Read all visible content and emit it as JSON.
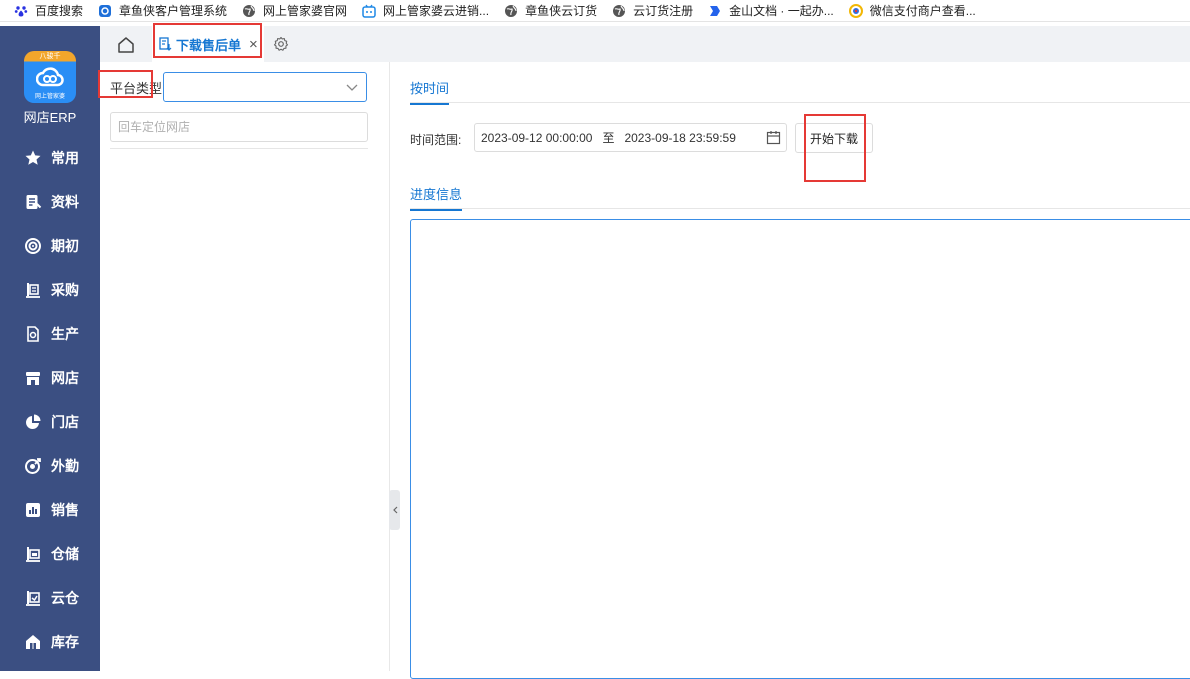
{
  "bookmarks": [
    {
      "label": "百度搜索",
      "icon": "baidu-paw-icon",
      "color": "#2932e1"
    },
    {
      "label": "章鱼侠客户管理系统",
      "icon": "app-square-icon",
      "color": "#1e6fd9"
    },
    {
      "label": "网上管家婆官网",
      "icon": "globe-icon",
      "color": "#555555"
    },
    {
      "label": "网上管家婆云进销...",
      "icon": "robot-tv-icon",
      "color": "#1e88e5"
    },
    {
      "label": "章鱼侠云订货",
      "icon": "globe-icon",
      "color": "#555555"
    },
    {
      "label": "云订货注册",
      "icon": "globe-icon",
      "color": "#555555"
    },
    {
      "label": "金山文档 · 一起办...",
      "icon": "kdocs-icon",
      "color": "#2463eb"
    },
    {
      "label": "微信支付商户查看...",
      "icon": "wechat-pay-icon",
      "color": "#f2b705"
    }
  ],
  "sidebar": {
    "logo_top": "八骏千",
    "logo_sub": "网上管家婆",
    "app_name": "网店ERP",
    "items": [
      {
        "label": "常用",
        "icon": "star-icon"
      },
      {
        "label": "资料",
        "icon": "document-icon"
      },
      {
        "label": "期初",
        "icon": "target-icon"
      },
      {
        "label": "采购",
        "icon": "purchase-icon"
      },
      {
        "label": "生产",
        "icon": "production-icon"
      },
      {
        "label": "网店",
        "icon": "shop-icon"
      },
      {
        "label": "门店",
        "icon": "pie-icon"
      },
      {
        "label": "外勤",
        "icon": "field-icon"
      },
      {
        "label": "销售",
        "icon": "bar-chart-icon"
      },
      {
        "label": "仓储",
        "icon": "warehouse-icon"
      },
      {
        "label": "云仓",
        "icon": "cloud-warehouse-icon"
      },
      {
        "label": "库存",
        "icon": "home-stock-icon"
      }
    ]
  },
  "tabs": {
    "active_label": "下载售后单",
    "close_glyph": "×"
  },
  "left_panel": {
    "platform_label": "平台类型",
    "platform_value": "",
    "shop_search_placeholder": "回车定位网店"
  },
  "right_panel": {
    "tab_time": "按时间",
    "time_range_label": "时间范围:",
    "start_datetime": "2023-09-12 00:00:00",
    "to_text": "至",
    "end_datetime": "2023-09-18 23:59:59",
    "start_button": "开始下载",
    "tab_progress": "进度信息",
    "progress_text": ""
  },
  "colors": {
    "sidebar_bg": "#3b4f82",
    "accent": "#1677d2",
    "annotation": "#e53935"
  }
}
